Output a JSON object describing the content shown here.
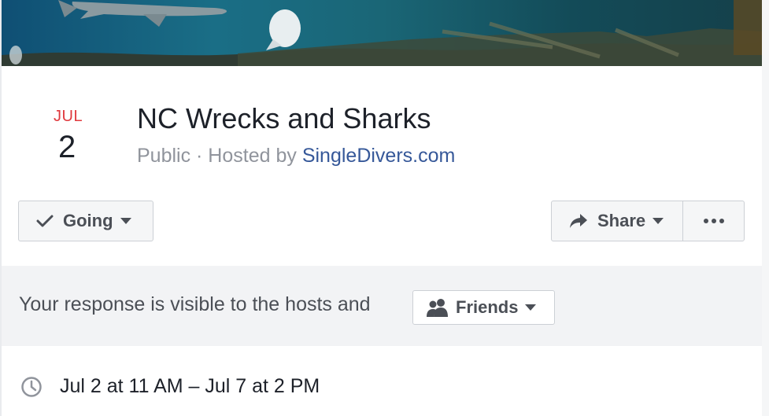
{
  "event": {
    "date_month": "JUL",
    "date_day": "2",
    "title": "NC Wrecks and Sharks",
    "privacy": "Public",
    "hosted_by_prefix": " · Hosted by ",
    "host_name": "SingleDivers.com"
  },
  "actions": {
    "going_label": "Going",
    "share_label": "Share"
  },
  "visibility": {
    "notice_text": "Your response is visible to the hosts and",
    "audience_label": "Friends"
  },
  "details": {
    "time_range": "Jul 2 at 11 AM – Jul 7 at 2 PM"
  },
  "icons": [
    "checkmark-icon",
    "caret-down-icon",
    "share-arrow-icon",
    "more-dots-icon",
    "friends-icon",
    "clock-icon"
  ],
  "colors": {
    "month_red": "#e0393e",
    "link_blue": "#365899",
    "muted_gray": "#90949c",
    "button_bg": "#f5f6f7",
    "notice_bg": "#f2f3f5"
  }
}
